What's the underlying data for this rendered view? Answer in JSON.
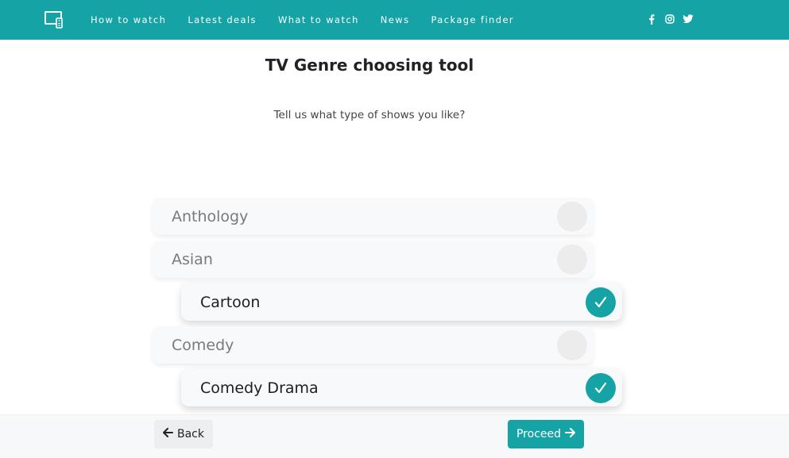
{
  "nav": {
    "items": [
      "How to watch",
      "Latest deals",
      "What to watch",
      "News",
      "Package finder"
    ],
    "logo_icon": "tv-remote-icon",
    "social_icons": [
      "facebook-icon",
      "instagram-icon",
      "twitter-icon"
    ]
  },
  "page": {
    "title": "TV Genre choosing tool",
    "subtitle": "Tell us what type of shows you like?"
  },
  "genres": [
    {
      "label": "Anthology",
      "selected": false
    },
    {
      "label": "Asian",
      "selected": false
    },
    {
      "label": "Cartoon",
      "selected": true
    },
    {
      "label": "Comedy",
      "selected": false
    },
    {
      "label": "Comedy Drama",
      "selected": true
    }
  ],
  "footer": {
    "back_label": "Back",
    "proceed_label": "Proceed"
  },
  "colors": {
    "accent": "#15a3a6",
    "toggle_off": "#ececec",
    "card_bg": "#f8f9fa"
  }
}
